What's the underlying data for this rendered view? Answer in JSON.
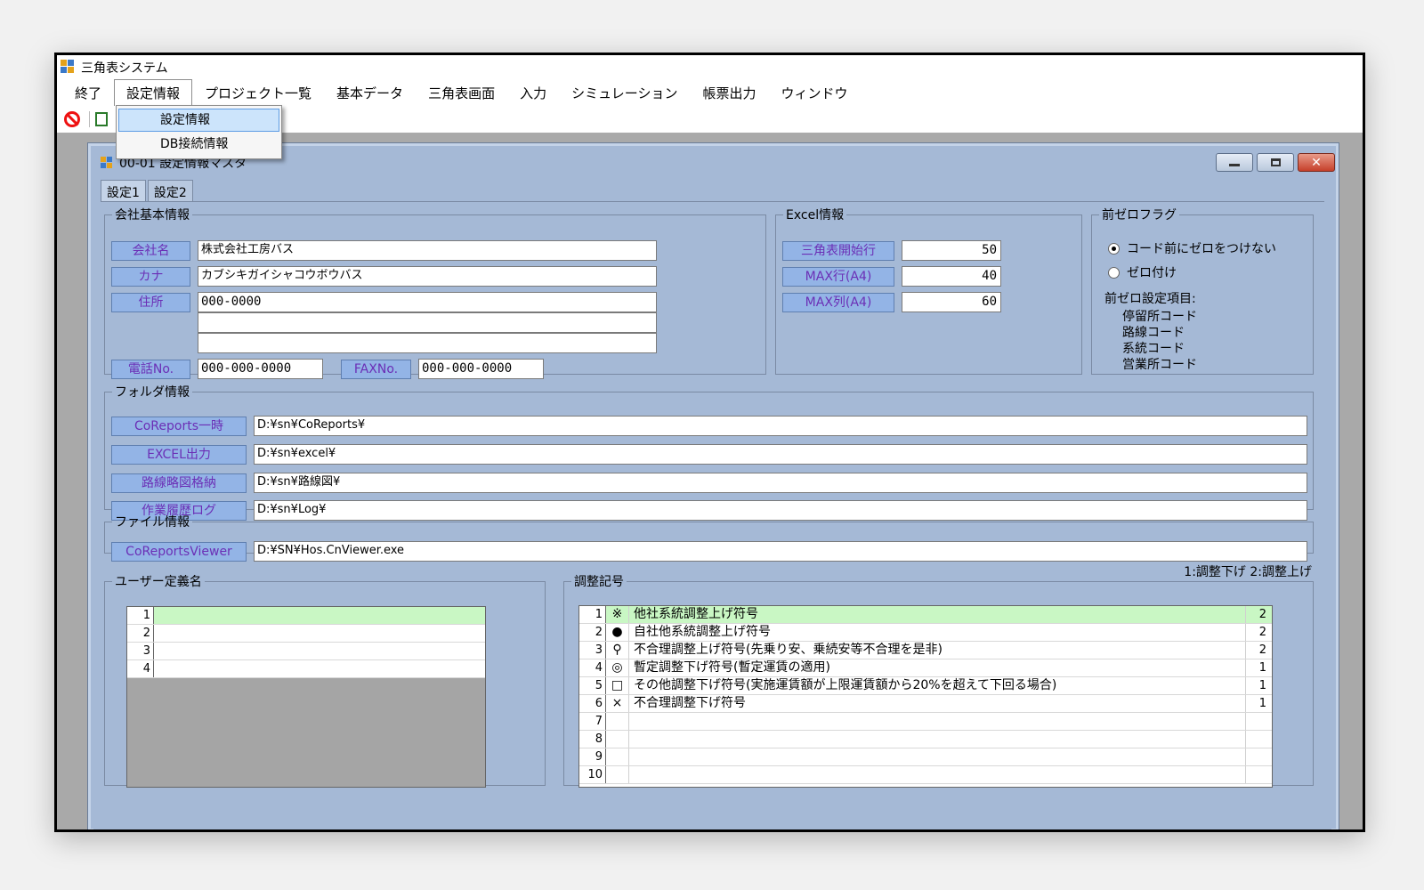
{
  "app": {
    "title": "三角表システム"
  },
  "menu": {
    "items": [
      "終了",
      "設定情報",
      "プロジェクト一覧",
      "基本データ",
      "三角表画面",
      "入力",
      "シミュレーション",
      "帳票出力",
      "ウィンドウ"
    ],
    "open_index": 1,
    "dropdown": [
      "設定情報",
      "DB接続情報"
    ],
    "highlighted": 0
  },
  "child": {
    "title": "00-01 設定情報マスタ"
  },
  "tabs": [
    "設定1",
    "設定2"
  ],
  "company": {
    "legend": "会社基本情報",
    "name_label": "会社名",
    "name_value": "株式会社工房バス",
    "kana_label": "カナ",
    "kana_value": "カブシキガイシャコウボウバス",
    "address_label": "住所",
    "address_line1": "000-0000",
    "address_line2": "",
    "address_line3": "",
    "tel_label": "電話No.",
    "tel_value": "000-000-0000",
    "fax_label": "FAXNo.",
    "fax_value": "000-000-0000"
  },
  "excel": {
    "legend": "Excel情報",
    "start_row_label": "三角表開始行",
    "start_row_value": "50",
    "max_row_label": "MAX行(A4)",
    "max_row_value": "40",
    "max_col_label": "MAX列(A4)",
    "max_col_value": "60"
  },
  "zero_flag": {
    "legend": "前ゼロフラグ",
    "option1": "コード前にゼロをつけない",
    "option2": "ゼロ付け",
    "selected": 0,
    "items_label": "前ゼロ設定項目:",
    "items": [
      "停留所コード",
      "路線コード",
      "系統コード",
      "営業所コード"
    ]
  },
  "folder": {
    "legend": "フォルダ情報",
    "rows": [
      {
        "label": "CoReports一時",
        "value": "D:¥sn¥CoReports¥"
      },
      {
        "label": "EXCEL出力",
        "value": "D:¥sn¥excel¥"
      },
      {
        "label": "路線略図格納",
        "value": "D:¥sn¥路線図¥"
      },
      {
        "label": "作業履歴ログ",
        "value": "D:¥sn¥Log¥"
      }
    ]
  },
  "file": {
    "legend": "ファイル情報",
    "label": "CoReportsViewer",
    "value": "D:¥SN¥Hos.CnViewer.exe"
  },
  "adjust_note": "1:調整下げ  2:調整上げ",
  "user_defined": {
    "legend": "ユーザー定義名",
    "rows": [
      {
        "no": "1",
        "value": ""
      },
      {
        "no": "2",
        "value": ""
      },
      {
        "no": "3",
        "value": ""
      },
      {
        "no": "4",
        "value": ""
      }
    ]
  },
  "adjust_symbols": {
    "legend": "調整記号",
    "rows": [
      {
        "no": "1",
        "symbol": "※",
        "text": "他社系統調整上げ符号",
        "value": "2"
      },
      {
        "no": "2",
        "symbol": "●",
        "text": "自社他系統調整上げ符号",
        "value": "2"
      },
      {
        "no": "3",
        "symbol": "⚲",
        "text": "不合理調整上げ符号(先乗り安、乗続安等不合理を是非)",
        "value": "2"
      },
      {
        "no": "4",
        "symbol": "◎",
        "text": "暫定調整下げ符号(暫定運賃の適用)",
        "value": "1"
      },
      {
        "no": "5",
        "symbol": "□",
        "text": "その他調整下げ符号(実施運賃額が上限運賃額から20%を超えて下回る場合)",
        "value": "1"
      },
      {
        "no": "6",
        "symbol": "×",
        "text": "不合理調整下げ符号",
        "value": "1"
      },
      {
        "no": "7",
        "symbol": "",
        "text": "",
        "value": ""
      },
      {
        "no": "8",
        "symbol": "",
        "text": "",
        "value": ""
      },
      {
        "no": "9",
        "symbol": "",
        "text": "",
        "value": ""
      },
      {
        "no": "10",
        "symbol": "",
        "text": "",
        "value": ""
      }
    ]
  }
}
